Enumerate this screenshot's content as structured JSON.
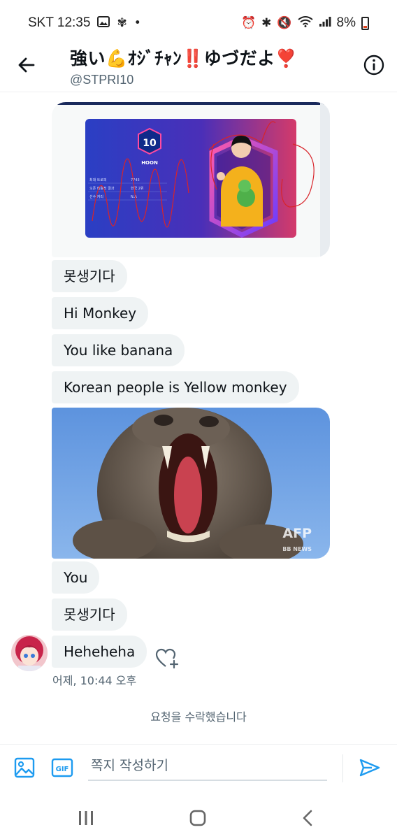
{
  "status_bar": {
    "carrier_time": "SKT 12:35",
    "battery": "8%",
    "icons": [
      "image-icon",
      "fan-icon",
      "dot-icon",
      "alarm-icon",
      "bluetooth-icon",
      "mute-icon",
      "wifi-icon",
      "signal-icon",
      "battery-icon"
    ]
  },
  "header": {
    "title": "強い💪ｵｼﾞﾁｬﾝ‼️ゆづだよ❣️",
    "handle": "@STPRI10",
    "back_icon": "arrow-left-icon",
    "info_icon": "info-icon"
  },
  "card": {
    "logo_text": "10",
    "player_name": "HOON",
    "stats": [
      {
        "label": "최대 트로피",
        "value": "7743"
      },
      {
        "label": "오픈 배틀전 결과",
        "value": "한국 2위"
      },
      {
        "label": "선수 커리",
        "value": "N.A"
      }
    ]
  },
  "messages": [
    {
      "text": "못생기다"
    },
    {
      "text": "Hi Monkey"
    },
    {
      "text": "You like banana"
    },
    {
      "text": "Korean people is Yellow monkey"
    },
    {
      "text": "You"
    },
    {
      "text": "못생기다"
    },
    {
      "text": "Heheheha"
    }
  ],
  "photo": {
    "watermark": "AFP",
    "watermark_sub": "BB NEWS"
  },
  "timestamp": "어제, 10:44 오후",
  "system_message": "요청을 수락했습니다",
  "composer": {
    "placeholder": "쪽지 작성하기",
    "gif_label": "GIF"
  },
  "colors": {
    "accent": "#1d9bf0",
    "bubble": "#eff3f4",
    "muted": "#536471"
  }
}
